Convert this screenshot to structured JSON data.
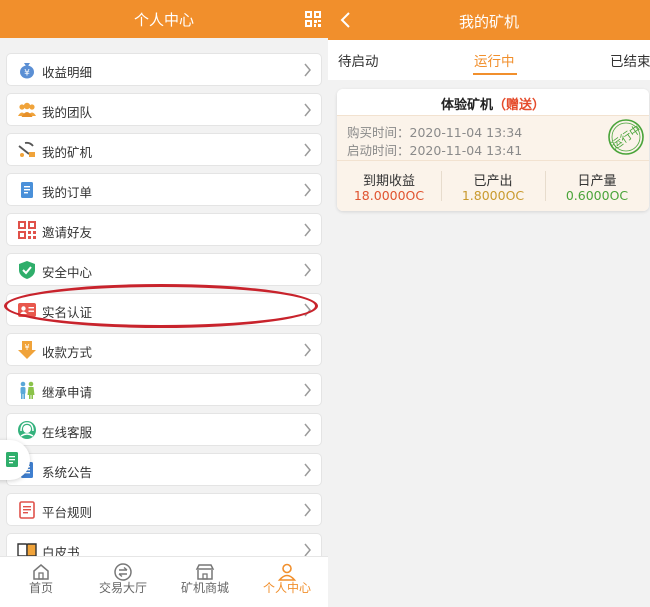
{
  "left": {
    "title": "个人中心",
    "menu": [
      {
        "label": "收益明细",
        "icon": "money-bag-icon"
      },
      {
        "label": "我的团队",
        "icon": "team-icon"
      },
      {
        "label": "我的矿机",
        "icon": "mining-machine-icon"
      },
      {
        "label": "我的订单",
        "icon": "order-icon"
      },
      {
        "label": "邀请好友",
        "icon": "qr-code-icon"
      },
      {
        "label": "安全中心",
        "icon": "shield-icon"
      },
      {
        "label": "实名认证",
        "icon": "id-card-icon"
      },
      {
        "label": "收款方式",
        "icon": "yen-arrow-icon"
      },
      {
        "label": "继承申请",
        "icon": "people-icon"
      },
      {
        "label": "在线客服",
        "icon": "headset-icon"
      },
      {
        "label": "系统公告",
        "icon": "notice-icon"
      },
      {
        "label": "平台规则",
        "icon": "rules-icon"
      },
      {
        "label": "白皮书",
        "icon": "book-icon"
      }
    ],
    "tabs": [
      {
        "label": "首页",
        "icon": "home-icon"
      },
      {
        "label": "交易大厅",
        "icon": "exchange-icon"
      },
      {
        "label": "矿机商城",
        "icon": "store-icon"
      },
      {
        "label": "个人中心",
        "icon": "user-icon"
      }
    ]
  },
  "right": {
    "title": "我的矿机",
    "tabs": [
      "待启动",
      "运行中",
      "已结束"
    ],
    "card": {
      "title": "体验矿机",
      "badge": "（赠送）",
      "purchase_label": "购买时间：",
      "purchase_time": "2020-11-04 13:34",
      "start_label": "启动时间：",
      "start_time": "2020-11-04 13:41",
      "stamp": "运行中",
      "stats": [
        {
          "label": "到期收益",
          "value": "18.0000OC",
          "color": "#e0532f"
        },
        {
          "label": "已产出",
          "value": "1.8000OC",
          "color": "#c99a2e"
        },
        {
          "label": "日产量",
          "value": "0.6000OC",
          "color": "#4aa43a"
        }
      ]
    }
  },
  "colors": {
    "accent": "#f18f2c",
    "annotation": "#c8232c"
  }
}
